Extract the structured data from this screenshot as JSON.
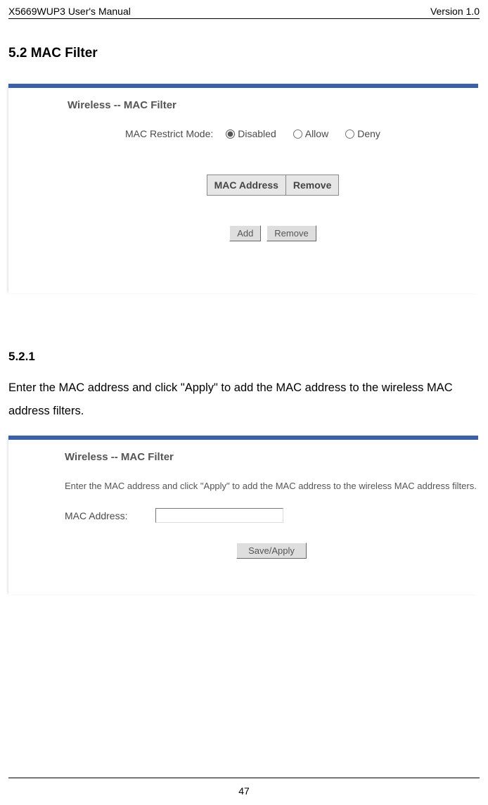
{
  "header": {
    "left": "X5669WUP3 User's Manual",
    "right": "Version 1.0"
  },
  "section": {
    "title": "5.2 MAC Filter",
    "subtitle": "5.2.1",
    "body": "Enter the MAC address and click \"Apply\" to add the MAC address to the wireless MAC address filters."
  },
  "shot1": {
    "title": "Wireless -- MAC Filter",
    "restrict_label": "MAC Restrict Mode:",
    "opt_disabled": "Disabled",
    "opt_allow": "Allow",
    "opt_deny": "Deny",
    "col1": "MAC Address",
    "col2": "Remove",
    "btn_add": "Add",
    "btn_remove": "Remove"
  },
  "shot2": {
    "title": "Wireless -- MAC Filter",
    "desc": "Enter the MAC address and click \"Apply\" to add the MAC address to the wireless MAC address filters.",
    "mac_label": "MAC Address:",
    "btn_save": "Save/Apply"
  },
  "page": "47"
}
